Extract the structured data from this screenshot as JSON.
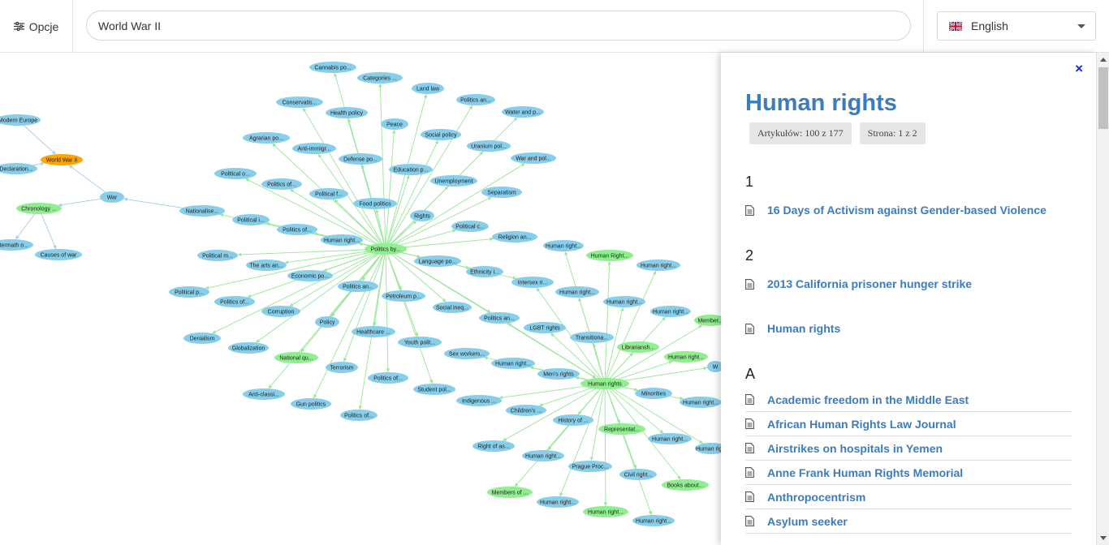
{
  "topbar": {
    "options_label": "Opcje",
    "search_value": "World War II",
    "language": "English"
  },
  "colors": {
    "node_blue": "#87ceeb",
    "node_green": "#90ee90",
    "node_orange": "#ffa500",
    "edge_blue": "#a4cde6",
    "edge_green": "#98e698",
    "link": "#3b7cbf",
    "close": "#0b2ae0"
  },
  "graph": {
    "nodes": [
      {
        "id": "modern-europe",
        "label": "Modern Europe",
        "color": "blue"
      },
      {
        "id": "ww2",
        "label": "World War II",
        "color": "orange"
      },
      {
        "id": "declaration",
        "label": "Declaration...",
        "color": "blue"
      },
      {
        "id": "war",
        "label": "War",
        "color": "blue"
      },
      {
        "id": "chronology",
        "label": "Chronology ...",
        "color": "green"
      },
      {
        "id": "aftermath",
        "label": "Aftermath o...",
        "color": "blue"
      },
      {
        "id": "causes",
        "label": "Causes of war",
        "color": "blue"
      },
      {
        "id": "nationalise",
        "label": "Nationalise...",
        "color": "blue"
      },
      {
        "id": "cannabis",
        "label": "Cannabis po...",
        "color": "blue"
      },
      {
        "id": "categories",
        "label": "Categories ...",
        "color": "blue"
      },
      {
        "id": "landlaw",
        "label": "Land law",
        "color": "blue"
      },
      {
        "id": "politicsan1",
        "label": "Politics an...",
        "color": "blue"
      },
      {
        "id": "conservatis",
        "label": "Conservatis...",
        "color": "blue"
      },
      {
        "id": "health",
        "label": "Health policy",
        "color": "blue"
      },
      {
        "id": "peace",
        "label": "Peace",
        "color": "blue"
      },
      {
        "id": "water",
        "label": "Water and p...",
        "color": "blue"
      },
      {
        "id": "social",
        "label": "Social policy",
        "color": "blue"
      },
      {
        "id": "agrarian",
        "label": "Agrarian po...",
        "color": "blue"
      },
      {
        "id": "antiimmigr",
        "label": "Anti-immigr...",
        "color": "blue"
      },
      {
        "id": "uranium",
        "label": "Uranium pol...",
        "color": "blue"
      },
      {
        "id": "defense",
        "label": "Defense po...",
        "color": "blue"
      },
      {
        "id": "education",
        "label": "Education p...",
        "color": "blue"
      },
      {
        "id": "warandpol",
        "label": "War and pol...",
        "color": "blue"
      },
      {
        "id": "politicalo",
        "label": "Political o...",
        "color": "blue"
      },
      {
        "id": "politicsof1",
        "label": "Politics of...",
        "color": "blue"
      },
      {
        "id": "unemploy",
        "label": "Unemployment",
        "color": "blue"
      },
      {
        "id": "politicalf",
        "label": "Political f...",
        "color": "blue"
      },
      {
        "id": "separatism",
        "label": "Separatism",
        "color": "blue"
      },
      {
        "id": "food",
        "label": "Food politics",
        "color": "blue"
      },
      {
        "id": "rights",
        "label": "Rights",
        "color": "blue"
      },
      {
        "id": "politicali",
        "label": "Political i...",
        "color": "blue"
      },
      {
        "id": "politicsof2",
        "label": "Politics of...",
        "color": "blue"
      },
      {
        "id": "politicalc",
        "label": "Political c...",
        "color": "blue"
      },
      {
        "id": "religion",
        "label": "Religion an...",
        "color": "blue"
      },
      {
        "id": "humanright1",
        "label": "Human right...",
        "color": "blue"
      },
      {
        "id": "politicsby",
        "label": "Politics by...",
        "color": "green"
      },
      {
        "id": "humanright2",
        "label": "Human right...",
        "color": "blue"
      },
      {
        "id": "humanRight3",
        "label": "Human Right...",
        "color": "green"
      },
      {
        "id": "politicalm",
        "label": "Political m...",
        "color": "blue"
      },
      {
        "id": "artsan",
        "label": "The arts an...",
        "color": "blue"
      },
      {
        "id": "language",
        "label": "Language po...",
        "color": "blue"
      },
      {
        "id": "humanright4",
        "label": "Human right...",
        "color": "blue"
      },
      {
        "id": "economic",
        "label": "Economic po...",
        "color": "blue"
      },
      {
        "id": "ethnicity",
        "label": "Ethnicity i...",
        "color": "blue"
      },
      {
        "id": "politicalp",
        "label": "Political p...",
        "color": "blue"
      },
      {
        "id": "politicsan2",
        "label": "Politics an...",
        "color": "blue"
      },
      {
        "id": "intersex",
        "label": "Intersex ri...",
        "color": "blue"
      },
      {
        "id": "humanright5",
        "label": "Human right...",
        "color": "blue"
      },
      {
        "id": "politicsof3",
        "label": "Politics of...",
        "color": "blue"
      },
      {
        "id": "petroleum",
        "label": "Petroleum p...",
        "color": "blue"
      },
      {
        "id": "humanright6",
        "label": "Human right...",
        "color": "blue"
      },
      {
        "id": "socialineq",
        "label": "Social ineq...",
        "color": "blue"
      },
      {
        "id": "corruption",
        "label": "Corruption",
        "color": "blue"
      },
      {
        "id": "humanright7",
        "label": "Human right...",
        "color": "blue"
      },
      {
        "id": "politicsan3",
        "label": "Politics an...",
        "color": "blue"
      },
      {
        "id": "member1",
        "label": "Member...",
        "color": "green"
      },
      {
        "id": "policy",
        "label": "Policy",
        "color": "blue"
      },
      {
        "id": "lgbt",
        "label": "LGBT rights",
        "color": "blue"
      },
      {
        "id": "denialism",
        "label": "Denialism",
        "color": "blue"
      },
      {
        "id": "healthcare",
        "label": "Healthcare ...",
        "color": "blue"
      },
      {
        "id": "transitiona",
        "label": "Transitiona...",
        "color": "blue"
      },
      {
        "id": "globalization",
        "label": "Globalization",
        "color": "blue"
      },
      {
        "id": "youth",
        "label": "Youth polit...",
        "color": "blue"
      },
      {
        "id": "librariansh",
        "label": "Librariansh...",
        "color": "green"
      },
      {
        "id": "nationalqu",
        "label": "National qu...",
        "color": "green"
      },
      {
        "id": "sexworkers",
        "label": "Sex workers...",
        "color": "blue"
      },
      {
        "id": "humanright8",
        "label": "Human right...",
        "color": "green"
      },
      {
        "id": "humanright9",
        "label": "Human right...",
        "color": "blue"
      },
      {
        "id": "terrorism",
        "label": "Terrorism",
        "color": "blue"
      },
      {
        "id": "mensrights",
        "label": "Men's rights",
        "color": "blue"
      },
      {
        "id": "politicsof4",
        "label": "Politics of...",
        "color": "blue"
      },
      {
        "id": "humanrights",
        "label": "Human rights",
        "color": "green"
      },
      {
        "id": "minorities",
        "label": "Minorities",
        "color": "blue"
      },
      {
        "id": "anticlassi",
        "label": "Anti-classi...",
        "color": "blue"
      },
      {
        "id": "student",
        "label": "Student pol...",
        "color": "blue"
      },
      {
        "id": "gun",
        "label": "Gun politics",
        "color": "blue"
      },
      {
        "id": "indigenous",
        "label": "Indigenous ...",
        "color": "blue"
      },
      {
        "id": "humanright10",
        "label": "Human right...",
        "color": "blue"
      },
      {
        "id": "childrens",
        "label": "Children's ...",
        "color": "blue"
      },
      {
        "id": "politicsof5",
        "label": "Politics of...",
        "color": "blue"
      },
      {
        "id": "historyof",
        "label": "History of ...",
        "color": "blue"
      },
      {
        "id": "representat",
        "label": "Representat...",
        "color": "green"
      },
      {
        "id": "humanright11",
        "label": "Human right...",
        "color": "blue"
      },
      {
        "id": "rightofas",
        "label": "Right of as...",
        "color": "blue"
      },
      {
        "id": "humanrig12",
        "label": "Human rig...",
        "color": "blue"
      },
      {
        "id": "humanright13",
        "label": "Human right...",
        "color": "blue"
      },
      {
        "id": "pragueproc",
        "label": "Prague Proc...",
        "color": "blue"
      },
      {
        "id": "civilright",
        "label": "Civil right...",
        "color": "blue"
      },
      {
        "id": "membersof",
        "label": "Members of ...",
        "color": "green"
      },
      {
        "id": "booksabout",
        "label": "Books about...",
        "color": "green"
      },
      {
        "id": "humanright14",
        "label": "Human right...",
        "color": "blue"
      },
      {
        "id": "humanright15",
        "label": "Human right...",
        "color": "green"
      },
      {
        "id": "humanright16",
        "label": "Human right...",
        "color": "blue"
      },
      {
        "id": "edgeW",
        "label": "W",
        "color": "blue"
      }
    ],
    "edges": [
      {
        "from": "modern-europe",
        "to": "ww2"
      },
      {
        "from": "declaration",
        "to": "ww2"
      },
      {
        "from": "war",
        "to": "ww2"
      },
      {
        "from": "war",
        "to": "chronology"
      },
      {
        "from": "nationalise",
        "to": "war"
      },
      {
        "from": "chronology",
        "to": "aftermath"
      },
      {
        "from": "chronology",
        "to": "causes"
      },
      {
        "from": "politicsby",
        "to": "nationalise"
      },
      {
        "from": "politicsby",
        "to": "cannabis"
      },
      {
        "from": "politicsby",
        "to": "categories"
      },
      {
        "from": "politicsby",
        "to": "landlaw"
      },
      {
        "from": "politicsby",
        "to": "politicsan1"
      },
      {
        "from": "politicsby",
        "to": "conservatis"
      },
      {
        "from": "politicsby",
        "to": "health"
      },
      {
        "from": "politicsby",
        "to": "peace"
      },
      {
        "from": "politicsby",
        "to": "water"
      },
      {
        "from": "politicsby",
        "to": "social"
      },
      {
        "from": "politicsby",
        "to": "agrarian"
      },
      {
        "from": "politicsby",
        "to": "antiimmigr"
      },
      {
        "from": "politicsby",
        "to": "uranium"
      },
      {
        "from": "politicsby",
        "to": "defense"
      },
      {
        "from": "politicsby",
        "to": "education"
      },
      {
        "from": "politicsby",
        "to": "warandpol"
      },
      {
        "from": "politicsby",
        "to": "politicalo"
      },
      {
        "from": "politicsby",
        "to": "politicsof1"
      },
      {
        "from": "politicsby",
        "to": "unemploy"
      },
      {
        "from": "politicsby",
        "to": "politicalf"
      },
      {
        "from": "politicsby",
        "to": "separatism"
      },
      {
        "from": "politicsby",
        "to": "food"
      },
      {
        "from": "politicsby",
        "to": "rights"
      },
      {
        "from": "politicsby",
        "to": "politicali"
      },
      {
        "from": "politicsby",
        "to": "politicsof2"
      },
      {
        "from": "politicsby",
        "to": "politicalc"
      },
      {
        "from": "politicsby",
        "to": "religion"
      },
      {
        "from": "politicsby",
        "to": "humanright1"
      },
      {
        "from": "politicsby",
        "to": "politicalm"
      },
      {
        "from": "politicsby",
        "to": "artsan"
      },
      {
        "from": "politicsby",
        "to": "language"
      },
      {
        "from": "politicsby",
        "to": "economic"
      },
      {
        "from": "politicsby",
        "to": "ethnicity"
      },
      {
        "from": "politicsby",
        "to": "politicalp"
      },
      {
        "from": "politicsby",
        "to": "politicsan2"
      },
      {
        "from": "politicsby",
        "to": "intersex"
      },
      {
        "from": "politicsby",
        "to": "politicsof3"
      },
      {
        "from": "politicsby",
        "to": "petroleum"
      },
      {
        "from": "politicsby",
        "to": "socialineq"
      },
      {
        "from": "politicsby",
        "to": "corruption"
      },
      {
        "from": "politicsby",
        "to": "politicsan3"
      },
      {
        "from": "politicsby",
        "to": "policy"
      },
      {
        "from": "politicsby",
        "to": "denialism"
      },
      {
        "from": "politicsby",
        "to": "healthcare"
      },
      {
        "from": "politicsby",
        "to": "globalization"
      },
      {
        "from": "politicsby",
        "to": "youth"
      },
      {
        "from": "politicsby",
        "to": "nationalqu"
      },
      {
        "from": "politicsby",
        "to": "terrorism"
      },
      {
        "from": "politicsby",
        "to": "politicsof4"
      },
      {
        "from": "politicsby",
        "to": "anticlassi"
      },
      {
        "from": "politicsby",
        "to": "student"
      },
      {
        "from": "politicsby",
        "to": "gun"
      },
      {
        "from": "politicsby",
        "to": "politicsof5"
      },
      {
        "from": "politicsby",
        "to": "humanrights"
      },
      {
        "from": "humanrights",
        "to": "humanright2"
      },
      {
        "from": "humanrights",
        "to": "humanRight3"
      },
      {
        "from": "humanrights",
        "to": "humanright4"
      },
      {
        "from": "humanrights",
        "to": "humanright5"
      },
      {
        "from": "humanrights",
        "to": "humanright6"
      },
      {
        "from": "humanrights",
        "to": "humanright7"
      },
      {
        "from": "humanrights",
        "to": "member1"
      },
      {
        "from": "humanrights",
        "to": "lgbt"
      },
      {
        "from": "humanrights",
        "to": "transitiona"
      },
      {
        "from": "humanrights",
        "to": "librariansh"
      },
      {
        "from": "humanrights",
        "to": "sexworkers"
      },
      {
        "from": "humanrights",
        "to": "humanright8"
      },
      {
        "from": "humanrights",
        "to": "humanright9"
      },
      {
        "from": "humanrights",
        "to": "mensrights"
      },
      {
        "from": "humanrights",
        "to": "minorities"
      },
      {
        "from": "humanrights",
        "to": "indigenous"
      },
      {
        "from": "humanrights",
        "to": "humanright10"
      },
      {
        "from": "humanrights",
        "to": "childrens"
      },
      {
        "from": "humanrights",
        "to": "historyof"
      },
      {
        "from": "humanrights",
        "to": "representat"
      },
      {
        "from": "humanrights",
        "to": "humanright11"
      },
      {
        "from": "humanrights",
        "to": "rightofas"
      },
      {
        "from": "humanrights",
        "to": "humanrig12"
      },
      {
        "from": "humanrights",
        "to": "humanright13"
      },
      {
        "from": "humanrights",
        "to": "pragueproc"
      },
      {
        "from": "humanrights",
        "to": "civilright"
      },
      {
        "from": "humanrights",
        "to": "membersof"
      },
      {
        "from": "humanrights",
        "to": "booksabout"
      },
      {
        "from": "humanrights",
        "to": "humanright14"
      },
      {
        "from": "humanrights",
        "to": "humanright15"
      },
      {
        "from": "humanrights",
        "to": "humanright16"
      },
      {
        "from": "humanrights",
        "to": "edgeW"
      },
      {
        "from": "humanrights",
        "to": "intersex"
      },
      {
        "from": "humanrights",
        "to": "politicsan3"
      }
    ]
  },
  "panel": {
    "close_label": "×",
    "title": "Human rights",
    "articles_badge": "Artykułów: 100 z 177",
    "page_badge": "Strona: 1 z 2",
    "sections": [
      {
        "heading": "1",
        "items": [
          "16 Days of Activism against Gender-based Violence"
        ]
      },
      {
        "heading": "2",
        "items": [
          "2013 California prisoner hunger strike",
          "Human rights"
        ]
      },
      {
        "heading": "A",
        "items": [
          "Academic freedom in the Middle East",
          "African Human Rights Law Journal",
          "Airstrikes on hospitals in Yemen",
          "Anne Frank Human Rights Memorial",
          "Anthropocentrism",
          "Asylum seeker"
        ]
      }
    ]
  }
}
